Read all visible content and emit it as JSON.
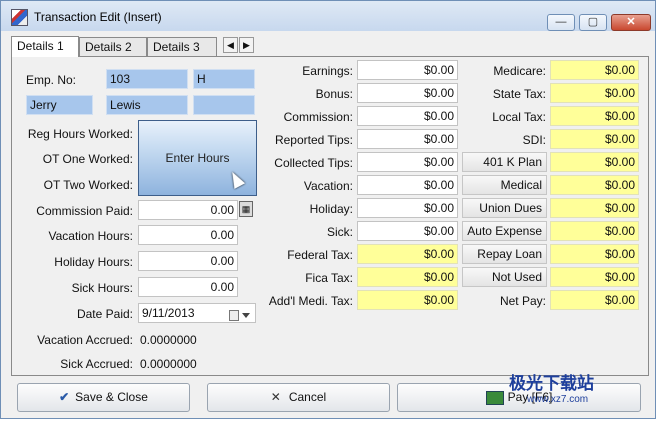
{
  "window": {
    "title": "Transaction Edit (Insert)"
  },
  "title_buttons": {
    "minimize": "—",
    "maximize": "▢",
    "close": "✕"
  },
  "tabs": [
    "Details 1",
    "Details 2",
    "Details 3"
  ],
  "employee": {
    "emp_no_label": "Emp. No:",
    "emp_no": "103",
    "emp_code": "H",
    "first_name": "Jerry",
    "last_name": "Lewis",
    "extra": ""
  },
  "hours": {
    "reg_label": "Reg Hours Worked:",
    "ot1_label": "OT One Worked:",
    "ot2_label": "OT Two Worked:",
    "enter_hours_label": "Enter Hours",
    "commission_paid_label": "Commission Paid:",
    "commission_paid": "0.00",
    "vacation_hours_label": "Vacation Hours:",
    "vacation_hours": "0.00",
    "holiday_hours_label": "Holiday Hours:",
    "holiday_hours": "0.00",
    "sick_hours_label": "Sick Hours:",
    "sick_hours": "0.00",
    "date_paid_label": "Date Paid:",
    "date_paid": "9/11/2013",
    "vacation_accrued_label": "Vacation Accrued:",
    "vacation_accrued": "0.0000000",
    "sick_accrued_label": "Sick Accrued:",
    "sick_accrued": "0.0000000"
  },
  "earnings": [
    {
      "label": "Earnings:",
      "value": "$0.00",
      "yellow": false
    },
    {
      "label": "Bonus:",
      "value": "$0.00",
      "yellow": false
    },
    {
      "label": "Commission:",
      "value": "$0.00",
      "yellow": false
    },
    {
      "label": "Reported Tips:",
      "value": "$0.00",
      "yellow": false
    },
    {
      "label": "Collected Tips:",
      "value": "$0.00",
      "yellow": false
    },
    {
      "label": "Vacation:",
      "value": "$0.00",
      "yellow": false
    },
    {
      "label": "Holiday:",
      "value": "$0.00",
      "yellow": false
    },
    {
      "label": "Sick:",
      "value": "$0.00",
      "yellow": false
    },
    {
      "label": "Federal Tax:",
      "value": "$0.00",
      "yellow": true
    },
    {
      "label": "Fica Tax:",
      "value": "$0.00",
      "yellow": true
    },
    {
      "label": "Add'l Medi. Tax:",
      "value": "$0.00",
      "yellow": true
    }
  ],
  "deductions": [
    {
      "label": "Medicare:",
      "value": "$0.00",
      "button": false
    },
    {
      "label": "State Tax:",
      "value": "$0.00",
      "button": false
    },
    {
      "label": "Local Tax:",
      "value": "$0.00",
      "button": false
    },
    {
      "label": "SDI:",
      "value": "$0.00",
      "button": false
    },
    {
      "label": "401 K Plan",
      "value": "$0.00",
      "button": true
    },
    {
      "label": "Medical",
      "value": "$0.00",
      "button": true
    },
    {
      "label": "Union Dues",
      "value": "$0.00",
      "button": true
    },
    {
      "label": "Auto Expense",
      "value": "$0.00",
      "button": true
    },
    {
      "label": "Repay Loan",
      "value": "$0.00",
      "button": true
    },
    {
      "label": "Not Used",
      "value": "$0.00",
      "button": true
    },
    {
      "label": "Net Pay:",
      "value": "$0.00",
      "button": false
    }
  ],
  "buttons": {
    "save_close": "Save & Close",
    "cancel": "Cancel",
    "pay": "Pay [F6]"
  },
  "watermark": {
    "text": "极光下载站",
    "url": "www.xz7.com"
  },
  "icons": [
    "app-icon",
    "check-icon",
    "x-icon",
    "pay-icon",
    "calculator-icon",
    "calendar-icon",
    "cursor-icon"
  ]
}
